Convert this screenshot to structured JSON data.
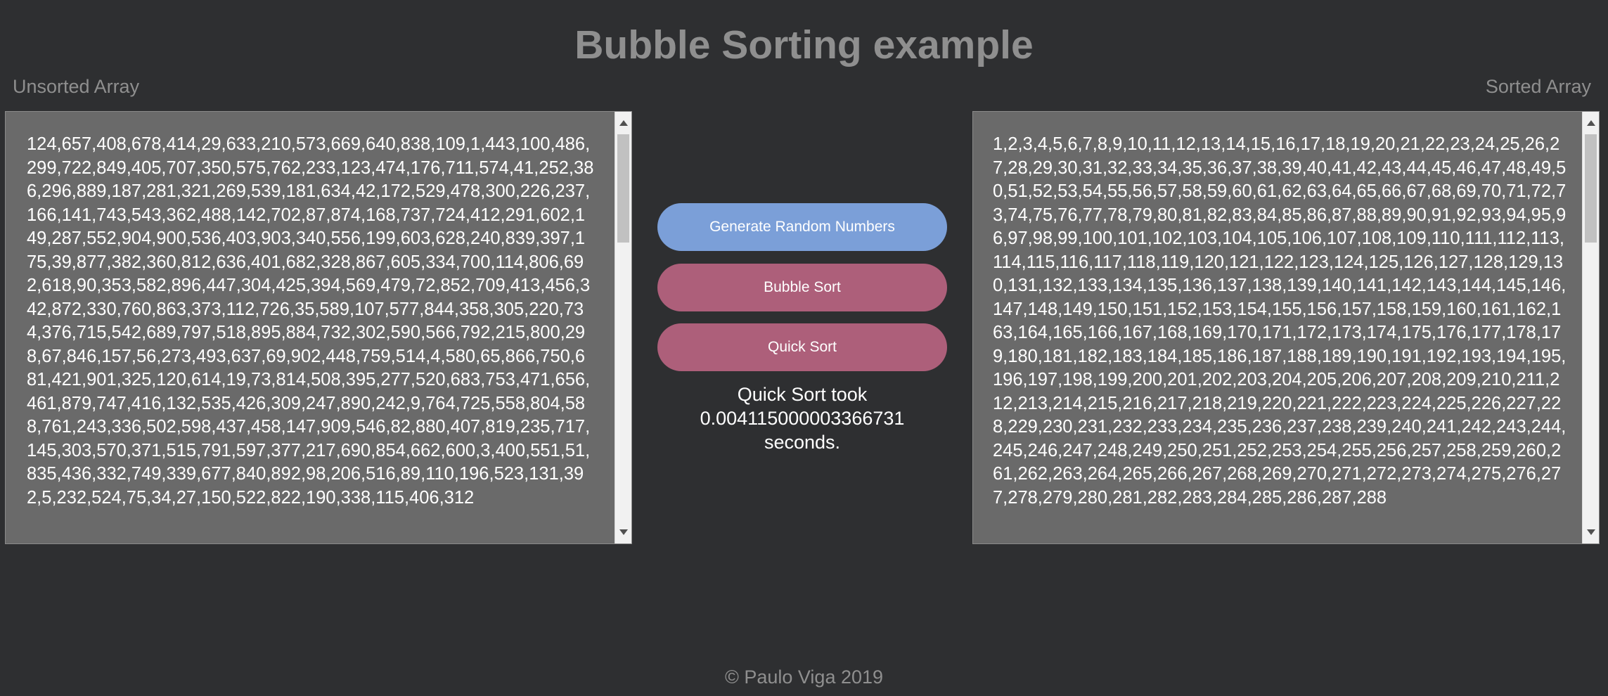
{
  "page": {
    "title": "Bubble Sorting example",
    "footer": "© Paulo Viga 2019"
  },
  "unsorted": {
    "label": "Unsorted Array",
    "text": "124,657,408,678,414,29,633,210,573,669,640,838,109,1,443,100,486,299,722,849,405,707,350,575,762,233,123,474,176,711,574,41,252,386,296,889,187,281,321,269,539,181,634,42,172,529,478,300,226,237,166,141,743,543,362,488,142,702,87,874,168,737,724,412,291,602,149,287,552,904,900,536,403,903,340,556,199,603,628,240,839,397,175,39,877,382,360,812,636,401,682,328,867,605,334,700,114,806,692,618,90,353,582,896,447,304,425,394,569,479,72,852,709,413,456,342,872,330,760,863,373,112,726,35,589,107,577,844,358,305,220,734,376,715,542,689,797,518,895,884,732,302,590,566,792,215,800,298,67,846,157,56,273,493,637,69,902,448,759,514,4,580,65,866,750,681,421,901,325,120,614,19,73,814,508,395,277,520,683,753,471,656,461,879,747,416,132,535,426,309,247,890,242,9,764,725,558,804,588,761,243,336,502,598,437,458,147,909,546,82,880,407,819,235,717,145,303,570,371,515,791,597,377,217,690,854,662,600,3,400,551,51,835,436,332,749,339,677,840,892,98,206,516,89,110,196,523,131,392,5,232,524,75,34,27,150,522,822,190,338,115,406,312"
  },
  "sorted": {
    "label": "Sorted Array",
    "text": "1,2,3,4,5,6,7,8,9,10,11,12,13,14,15,16,17,18,19,20,21,22,23,24,25,26,27,28,29,30,31,32,33,34,35,36,37,38,39,40,41,42,43,44,45,46,47,48,49,50,51,52,53,54,55,56,57,58,59,60,61,62,63,64,65,66,67,68,69,70,71,72,73,74,75,76,77,78,79,80,81,82,83,84,85,86,87,88,89,90,91,92,93,94,95,96,97,98,99,100,101,102,103,104,105,106,107,108,109,110,111,112,113,114,115,116,117,118,119,120,121,122,123,124,125,126,127,128,129,130,131,132,133,134,135,136,137,138,139,140,141,142,143,144,145,146,147,148,149,150,151,152,153,154,155,156,157,158,159,160,161,162,163,164,165,166,167,168,169,170,171,172,173,174,175,176,177,178,179,180,181,182,183,184,185,186,187,188,189,190,191,192,193,194,195,196,197,198,199,200,201,202,203,204,205,206,207,208,209,210,211,212,213,214,215,216,217,218,219,220,221,222,223,224,225,226,227,228,229,230,231,232,233,234,235,236,237,238,239,240,241,242,243,244,245,246,247,248,249,250,251,252,253,254,255,256,257,258,259,260,261,262,263,264,265,266,267,268,269,270,271,272,273,274,275,276,277,278,279,280,281,282,283,284,285,286,287,288"
  },
  "buttons": {
    "generate": "Generate Random Numbers",
    "bubble": "Bubble Sort",
    "quick": "Quick Sort"
  },
  "result": {
    "line1": "Quick Sort took",
    "line2": "0.004115000003366731",
    "line3": "seconds."
  },
  "colors": {
    "background": "#2e2f31",
    "heading": "#8f8f8f",
    "textbox": "#6a6a6a",
    "generate_button": "#7b9fd8",
    "sort_button": "#ad5f7a"
  }
}
